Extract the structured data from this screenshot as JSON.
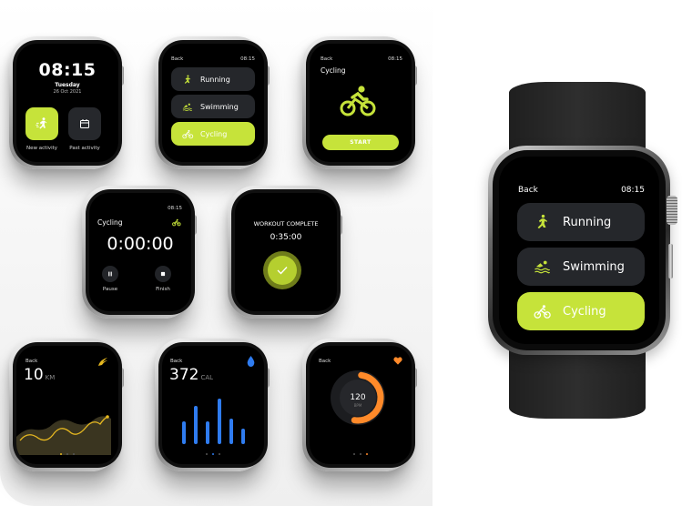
{
  "colors": {
    "accent": "#c6e33a",
    "tile_dark": "#26282c",
    "distance_accent": "#e6b820",
    "calories_accent": "#2f7cf0",
    "heart_accent": "#ff8a2a"
  },
  "home": {
    "time": "08:15",
    "day": "Tuesday",
    "date": "26 Oct 2021",
    "new_activity_label": "New activity",
    "past_activity_label": "Past activity",
    "new_activity_icon": "running-icon",
    "past_activity_icon": "calendar-icon"
  },
  "activity_list": {
    "back_label": "Back",
    "time": "08:15",
    "items": [
      {
        "label": "Running",
        "icon": "running-icon",
        "selected": false
      },
      {
        "label": "Swimming",
        "icon": "swimming-icon",
        "selected": false
      },
      {
        "label": "Cycling",
        "icon": "cycling-icon",
        "selected": true
      }
    ]
  },
  "start_screen": {
    "back_label": "Back",
    "time": "08:15",
    "title": "Cycling",
    "start_label": "START"
  },
  "timer_screen": {
    "time": "08:15",
    "title": "Cycling",
    "elapsed": "0:00:00",
    "pause_label": "Pause",
    "finish_label": "Finish"
  },
  "complete_screen": {
    "title": "WORKOUT COMPLETE",
    "duration": "0:35:00"
  },
  "distance_screen": {
    "back_label": "Back",
    "value": "10",
    "unit": "KM",
    "page": 1,
    "page_count": 3
  },
  "calories_screen": {
    "back_label": "Back",
    "value": "372",
    "unit": "CAL",
    "bars": [
      0.45,
      0.75,
      0.45,
      0.9,
      0.5,
      0.3
    ],
    "page": 2,
    "page_count": 3
  },
  "heart_screen": {
    "back_label": "Back",
    "value": "120",
    "unit": "BPM",
    "ring_progress": 0.5,
    "page": 3,
    "page_count": 3
  },
  "featured_watch": {
    "back_label": "Back",
    "time": "08:15",
    "items": [
      {
        "label": "Running",
        "icon": "running-icon",
        "selected": false
      },
      {
        "label": "Swimming",
        "icon": "swimming-icon",
        "selected": false
      },
      {
        "label": "Cycling",
        "icon": "cycling-icon",
        "selected": true
      }
    ]
  }
}
